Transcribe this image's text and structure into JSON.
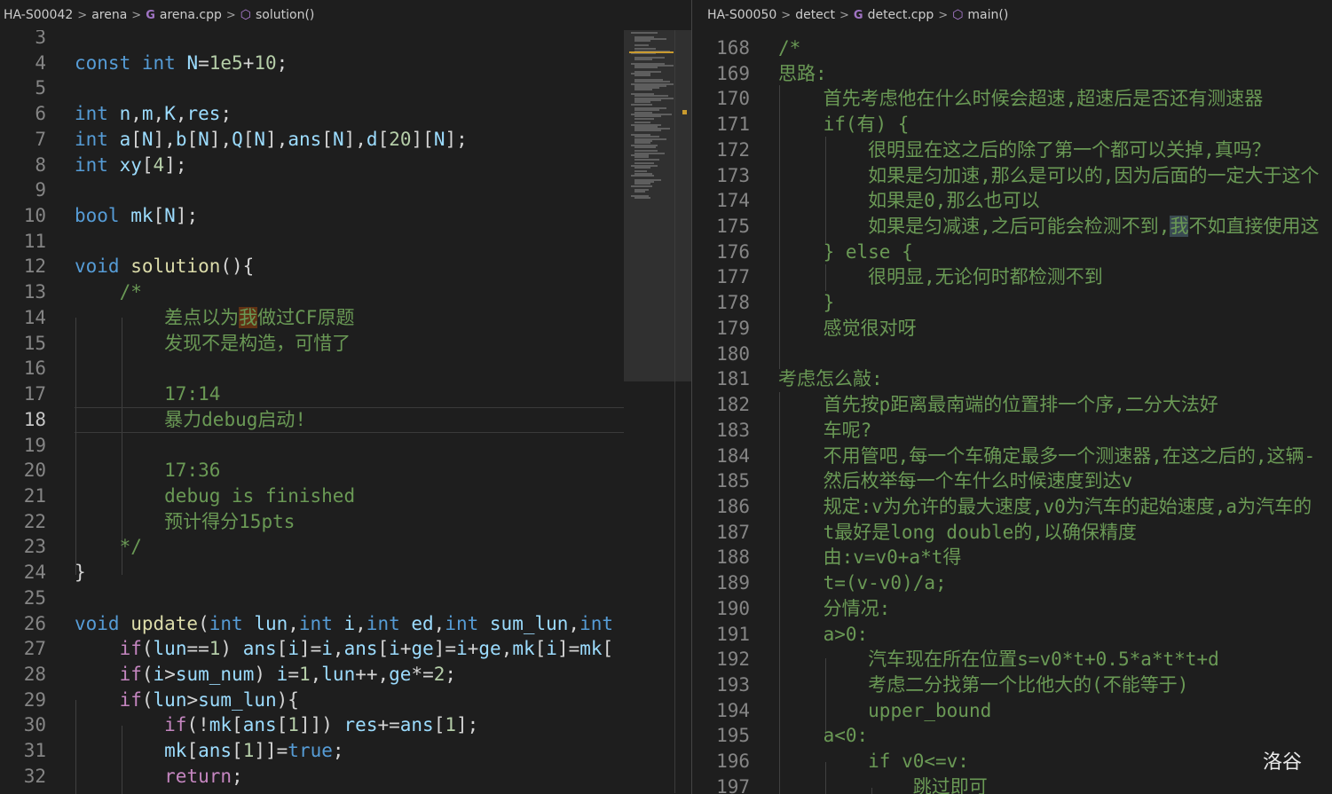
{
  "left": {
    "breadcrumb": {
      "folder": "HA-S00042",
      "subfolder": "arena",
      "file": "arena.cpp",
      "symbol": "solution()"
    },
    "active_line": "18"
  },
  "right": {
    "breadcrumb": {
      "folder": "HA-S00050",
      "subfolder": "detect",
      "file": "detect.cpp",
      "symbol": "main()"
    }
  },
  "watermark": "洛谷",
  "icons": {
    "separator": "chevron-right-icon",
    "file": "cpp-file-icon",
    "symbol": "symbol-method-icon"
  },
  "colors": {
    "background": "#1e1e1e",
    "keyword": "#569cd6",
    "comment": "#6a9955",
    "function": "#dcdcaa",
    "variable": "#9cdcfe",
    "number": "#b5cea8"
  }
}
